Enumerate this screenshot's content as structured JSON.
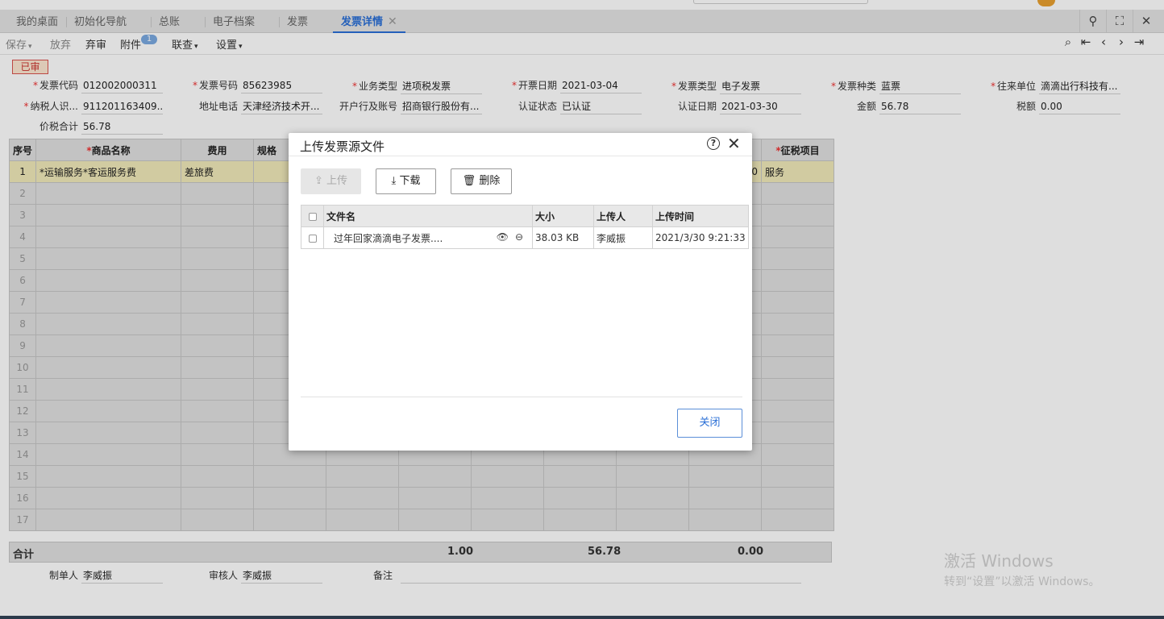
{
  "tabs": [
    {
      "label": "我的桌面"
    },
    {
      "label": "初始化导航"
    },
    {
      "label": "总账"
    },
    {
      "label": "电子档案"
    },
    {
      "label": "发票"
    },
    {
      "label": "发票详情"
    }
  ],
  "toolbar": {
    "save": "保存",
    "discard": "放弃",
    "abandon": "弃审",
    "attach": "附件",
    "attach_count": "1",
    "link": "联查",
    "settings": "设置"
  },
  "status": "已审",
  "form": {
    "invoice_code": {
      "label": "发票代码",
      "value": "012002000311"
    },
    "invoice_no": {
      "label": "发票号码",
      "value": "85623985"
    },
    "biz_type": {
      "label": "业务类型",
      "value": "进项税发票"
    },
    "issue_date": {
      "label": "开票日期",
      "value": "2021-03-04"
    },
    "inv_type": {
      "label": "发票类型",
      "value": "电子发票"
    },
    "inv_kind": {
      "label": "发票种类",
      "value": "蓝票"
    },
    "partner": {
      "label": "往来单位",
      "value": "滴滴出行科技有..."
    },
    "taxpayer_id": {
      "label": "纳税人识...",
      "value": "911201163409..."
    },
    "address_phone": {
      "label": "地址电话",
      "value": "天津经济技术开..."
    },
    "bank_account": {
      "label": "开户行及账号",
      "value": "招商银行股份有..."
    },
    "cert_status": {
      "label": "认证状态",
      "value": "已认证"
    },
    "cert_date": {
      "label": "认证日期",
      "value": "2021-03-30"
    },
    "amount": {
      "label": "金额",
      "value": "56.78"
    },
    "tax": {
      "label": "税额",
      "value": "0.00"
    },
    "total": {
      "label": "价税合计",
      "value": "56.78"
    }
  },
  "grid": {
    "headers": {
      "seq": "序号",
      "name": "商品名称",
      "expense": "费用",
      "spec": "规格",
      "tax_item": "征税项目"
    },
    "row1": {
      "seq": "1",
      "name": "*运输服务*客运服务费",
      "expense": "差旅费",
      "clipped": "0",
      "tax_item": "服务"
    },
    "row_nums": [
      "2",
      "3",
      "4",
      "5",
      "6",
      "7",
      "8",
      "9",
      "10",
      "11",
      "12",
      "13",
      "14",
      "15",
      "16",
      "17"
    ]
  },
  "summary": {
    "label": "合计",
    "qty": "1.00",
    "amount": "56.78",
    "tax": "0.00"
  },
  "footer": {
    "maker_label": "制单人",
    "maker": "李威振",
    "auditor_label": "审核人",
    "auditor": "李威振",
    "remark_label": "备注"
  },
  "dialog": {
    "title": "上传发票源文件",
    "upload": "上传",
    "download": "下载",
    "delete": "删除",
    "col_name": "文件名",
    "col_size": "大小",
    "col_uploader": "上传人",
    "col_time": "上传时间",
    "file": {
      "name": "过年回家滴滴电子发票....",
      "size": "38.03 KB",
      "uploader": "李威振",
      "time": "2021/3/30 9:21:33"
    },
    "close": "关闭"
  },
  "watermark": {
    "line1": "激活 Windows",
    "line2": "转到“设置”以激活 Windows。"
  }
}
